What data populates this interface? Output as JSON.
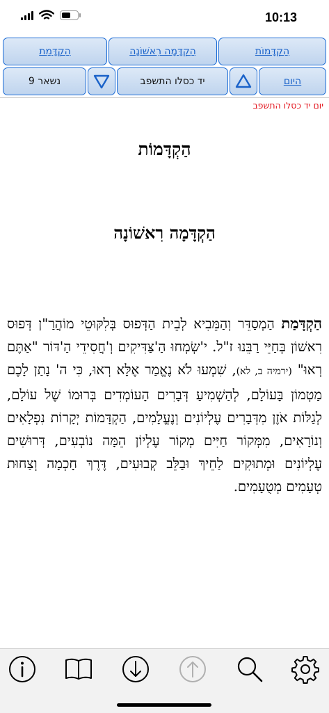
{
  "status": {
    "time": "10:13"
  },
  "toolbar": {
    "btn_hakdama": "הַקְדָּמַת",
    "btn_hakdama_rishona": "הַקְדָּמָה רִאשׁוֹנָה",
    "btn_hakdamot": "הַקְדָּמוֹת",
    "btn_remaining": "נשאר 9",
    "btn_date": "יד כסלו התשפב",
    "btn_today": "היום",
    "accent_color": "#1a6bd6"
  },
  "date_label": "יום יד כסלו התשפב",
  "content": {
    "title": "הַקְדָּמוֹת",
    "subtitle": "הַקְדָּמָה רִאשׁוֹנָה",
    "para_lead": "הַקְדָּמַת",
    "para_text_1": " הַמְסַדֵּר וְהַמֵּבִיא לְבֵית הַדְּפוּס בְּלִקּוּטֵי מוֹהֲרַ\"ן דְּפוּס רִאשׁוֹן בְּחַיֵּי רַבֵּנוּ ז\"ל. י'שְׂמְחוּ הַ'צַּדִּיקִים וְ'חֲסִידֵי הַ'דּוֹר \"אַתֶּם רְאוּ\" ",
    "para_cite": "(ירמיה ב, לא)",
    "para_text_2": ", שִׁמְעוּ לֹא נֶאֱמַר אֶלָּא רְאוּ, כִּי ה' נָתַן לָכֶם מַטְמוֹן בָּעוֹלָם, לְהַשְׁמִיעַ דְּבָרִים הָעוֹמְדִים בְּרוּמוֹ שֶׁל עוֹלָם, לְגַלּוֹת אֹזֶן מִדְּבָרִים עֶלְיוֹנִים וְנֶעֱלָמִים, הַקְדָּמוֹת יְקָרוֹת נִפְלָאִים וְנוֹרָאִים, מִמְּקוֹר חַיִּים מְקוֹר עֶלְיוֹן הֵמָּה נוֹבְעִים, דְּרוּשִׁים עֶלְיוֹנִים וּמְתוּקִים לַחֵיךְ וּבַלֵּב קְבוּעִים, דֶּרֶךְ חָכְמָה וְצַחוּת טְעָמִים מְטֻעָמִים."
  },
  "tabbar": {
    "icons": [
      "info-icon",
      "book-icon",
      "arrow-down-circle-icon",
      "arrow-up-circle-icon",
      "search-icon",
      "gear-icon"
    ]
  }
}
